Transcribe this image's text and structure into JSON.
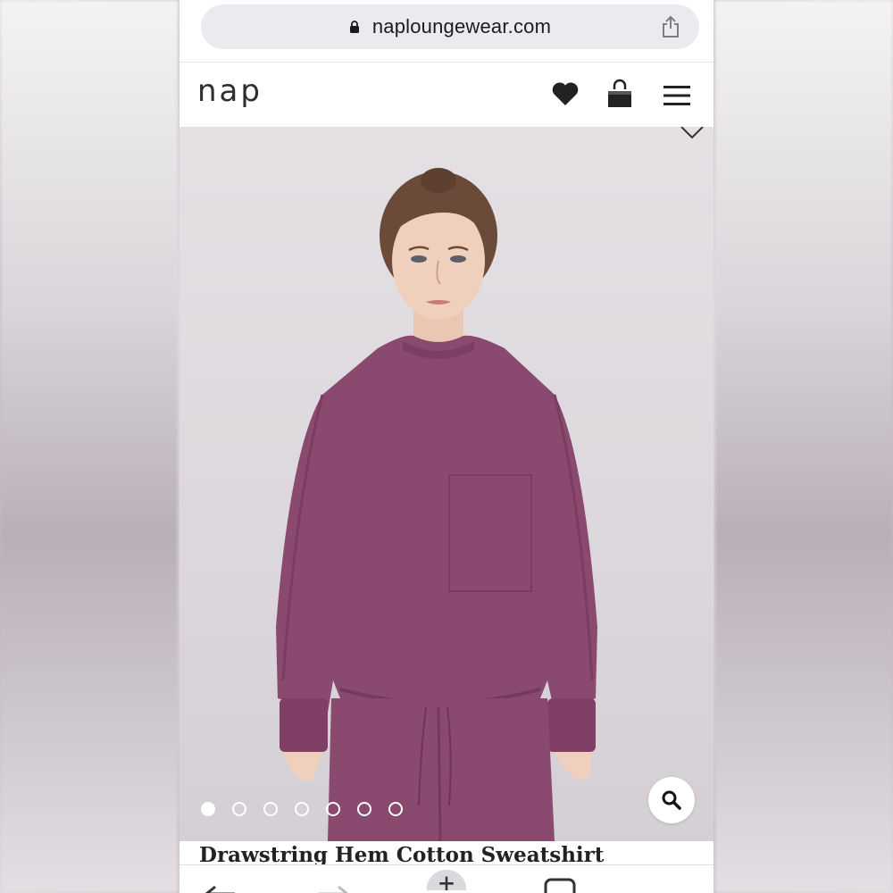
{
  "browser": {
    "url": "naploungewear.com"
  },
  "site": {
    "logo": "nap"
  },
  "product": {
    "title": "Drawstring Hem Cotton Sweatshirt",
    "image_count": 7,
    "active_image": 1,
    "garment_color": "#8a4a6f"
  },
  "icons": {
    "lock": "lock-icon",
    "share": "share-icon",
    "favorites": "heart-icon",
    "cart": "shopping-bag-icon",
    "menu": "hamburger-menu-icon",
    "wishlist_toggle": "heart-outline-icon",
    "zoom": "magnifier-icon",
    "toolbar": [
      "back-arrow-icon",
      "forward-arrow-icon",
      "new-tab-plus-icon",
      "tabs-icon",
      "more-icon"
    ]
  }
}
